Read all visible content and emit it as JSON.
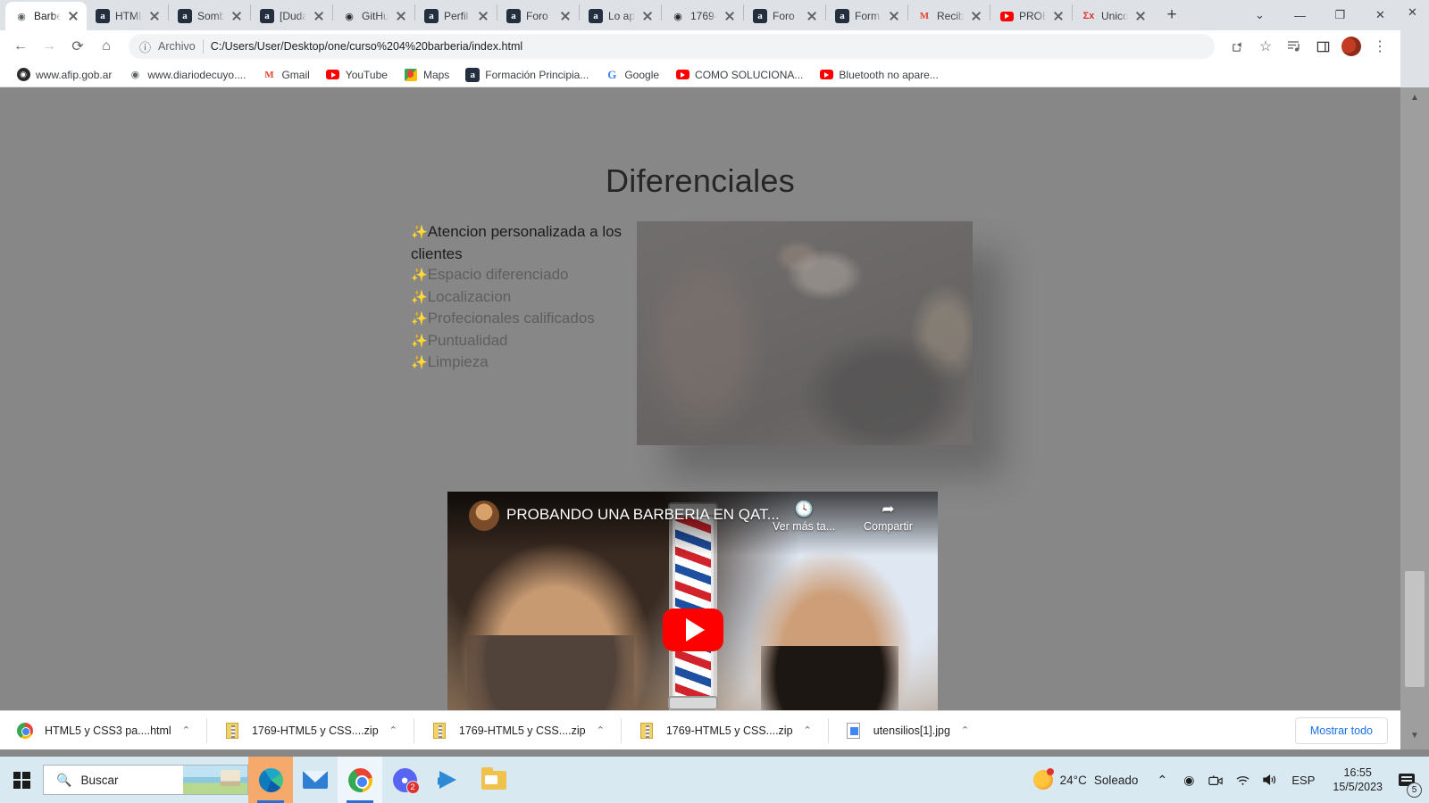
{
  "browser": {
    "tabs": [
      {
        "title": "Barbe",
        "icon": "globe-icon",
        "active": true
      },
      {
        "title": "HTML",
        "icon": "amazon-icon",
        "active": false
      },
      {
        "title": "Somb",
        "icon": "amazon-icon",
        "active": false
      },
      {
        "title": "[Duda",
        "icon": "amazon-icon",
        "active": false
      },
      {
        "title": "GitHu",
        "icon": "github-icon",
        "active": false
      },
      {
        "title": "Perfil",
        "icon": "amazon-icon",
        "active": false
      },
      {
        "title": "Foro",
        "icon": "amazon-icon",
        "active": false
      },
      {
        "title": "Lo ap",
        "icon": "amazon-icon",
        "active": false
      },
      {
        "title": "1769-",
        "icon": "github-icon",
        "active": false
      },
      {
        "title": "Foro",
        "icon": "amazon-icon",
        "active": false
      },
      {
        "title": "Form",
        "icon": "amazon-icon",
        "active": false
      },
      {
        "title": "Recib",
        "icon": "gmail-icon",
        "active": false
      },
      {
        "title": "PROB",
        "icon": "youtube-icon",
        "active": false
      },
      {
        "title": "Unico",
        "icon": "sigma-icon",
        "active": false
      }
    ],
    "new_tab_label": "+",
    "window_controls": {
      "tab_search": "⌄",
      "minimize": "—",
      "maximize": "❐",
      "close": "✕"
    },
    "toolbar": {
      "back": "←",
      "forward": "→",
      "reload": "⟳",
      "home": "⌂",
      "scheme_label": "Archivo",
      "url": "C:/Users/User/Desktop/one/curso%204%20barberia/index.html",
      "share": "share-icon",
      "bookmark": "☆",
      "reading_list": "reading-list-icon",
      "sidebar": "sidebar-icon",
      "menu": "⋮"
    },
    "bookmarks": [
      {
        "label": "www.afip.gob.ar",
        "icon": "afip-icon"
      },
      {
        "label": "www.diariodecuyo....",
        "icon": "globe-icon"
      },
      {
        "label": "Gmail",
        "icon": "gmail-icon"
      },
      {
        "label": "YouTube",
        "icon": "youtube-icon"
      },
      {
        "label": "Maps",
        "icon": "maps-icon"
      },
      {
        "label": "Formación Principia...",
        "icon": "amazon-icon"
      },
      {
        "label": "Google",
        "icon": "google-icon"
      },
      {
        "label": "COMO SOLUCIONA...",
        "icon": "youtube-icon"
      },
      {
        "label": "Bluetooth no apare...",
        "icon": "youtube-icon"
      }
    ]
  },
  "page": {
    "heading": "Diferenciales",
    "features": [
      {
        "sparkle": "✨",
        "text": "Atencion personalizada a los clientes"
      },
      {
        "sparkle": "✨",
        "text": "Espacio diferenciado"
      },
      {
        "sparkle": "✨",
        "text": "Localizacion"
      },
      {
        "sparkle": "✨",
        "text": "Profecionales calificados"
      },
      {
        "sparkle": "✨",
        "text": "Puntualidad"
      },
      {
        "sparkle": "✨",
        "text": "Limpieza"
      }
    ],
    "photo_alt": "barbero afeitando la barba de un cliente",
    "video": {
      "title": "PROBANDO UNA BARBERIA EN QAT...",
      "watch_later_label": "Ver más ta...",
      "share_label": "Compartir",
      "play_label": "play-button"
    },
    "background_color": "#878787"
  },
  "downloads": {
    "items": [
      {
        "name": "HTML5 y CSS3 pa....html",
        "icon": "chrome-file-icon",
        "caret": "⌃"
      },
      {
        "name": "1769-HTML5 y CSS....zip",
        "icon": "zip-file-icon",
        "caret": "⌃"
      },
      {
        "name": "1769-HTML5 y CSS....zip",
        "icon": "zip-file-icon",
        "caret": "⌃"
      },
      {
        "name": "1769-HTML5 y CSS....zip",
        "icon": "zip-file-icon",
        "caret": "⌃"
      },
      {
        "name": "utensilios[1].jpg",
        "icon": "image-file-icon",
        "caret": "⌃"
      }
    ],
    "show_all_label": "Mostrar todo"
  },
  "taskbar": {
    "start_label": "start-button",
    "search_placeholder": "Buscar",
    "apps": [
      {
        "name": "edge",
        "label": "Microsoft Edge"
      },
      {
        "name": "mail",
        "label": "Correo"
      },
      {
        "name": "chrome",
        "label": "Google Chrome"
      },
      {
        "name": "discord",
        "label": "Discord",
        "badge": "2"
      },
      {
        "name": "vscode",
        "label": "Visual Studio Code"
      },
      {
        "name": "explorer",
        "label": "Explorador de archivos"
      }
    ],
    "weather": {
      "temperature": "24°C",
      "condition": "Soleado"
    },
    "tray": {
      "overflow": "⌃",
      "record": "◉",
      "camera": "camera-icon",
      "network": "wifi-icon",
      "volume": "volume-icon",
      "language": "ESP"
    },
    "clock": {
      "time": "16:55",
      "date": "15/5/2023"
    },
    "notifications": {
      "count": "5"
    }
  }
}
